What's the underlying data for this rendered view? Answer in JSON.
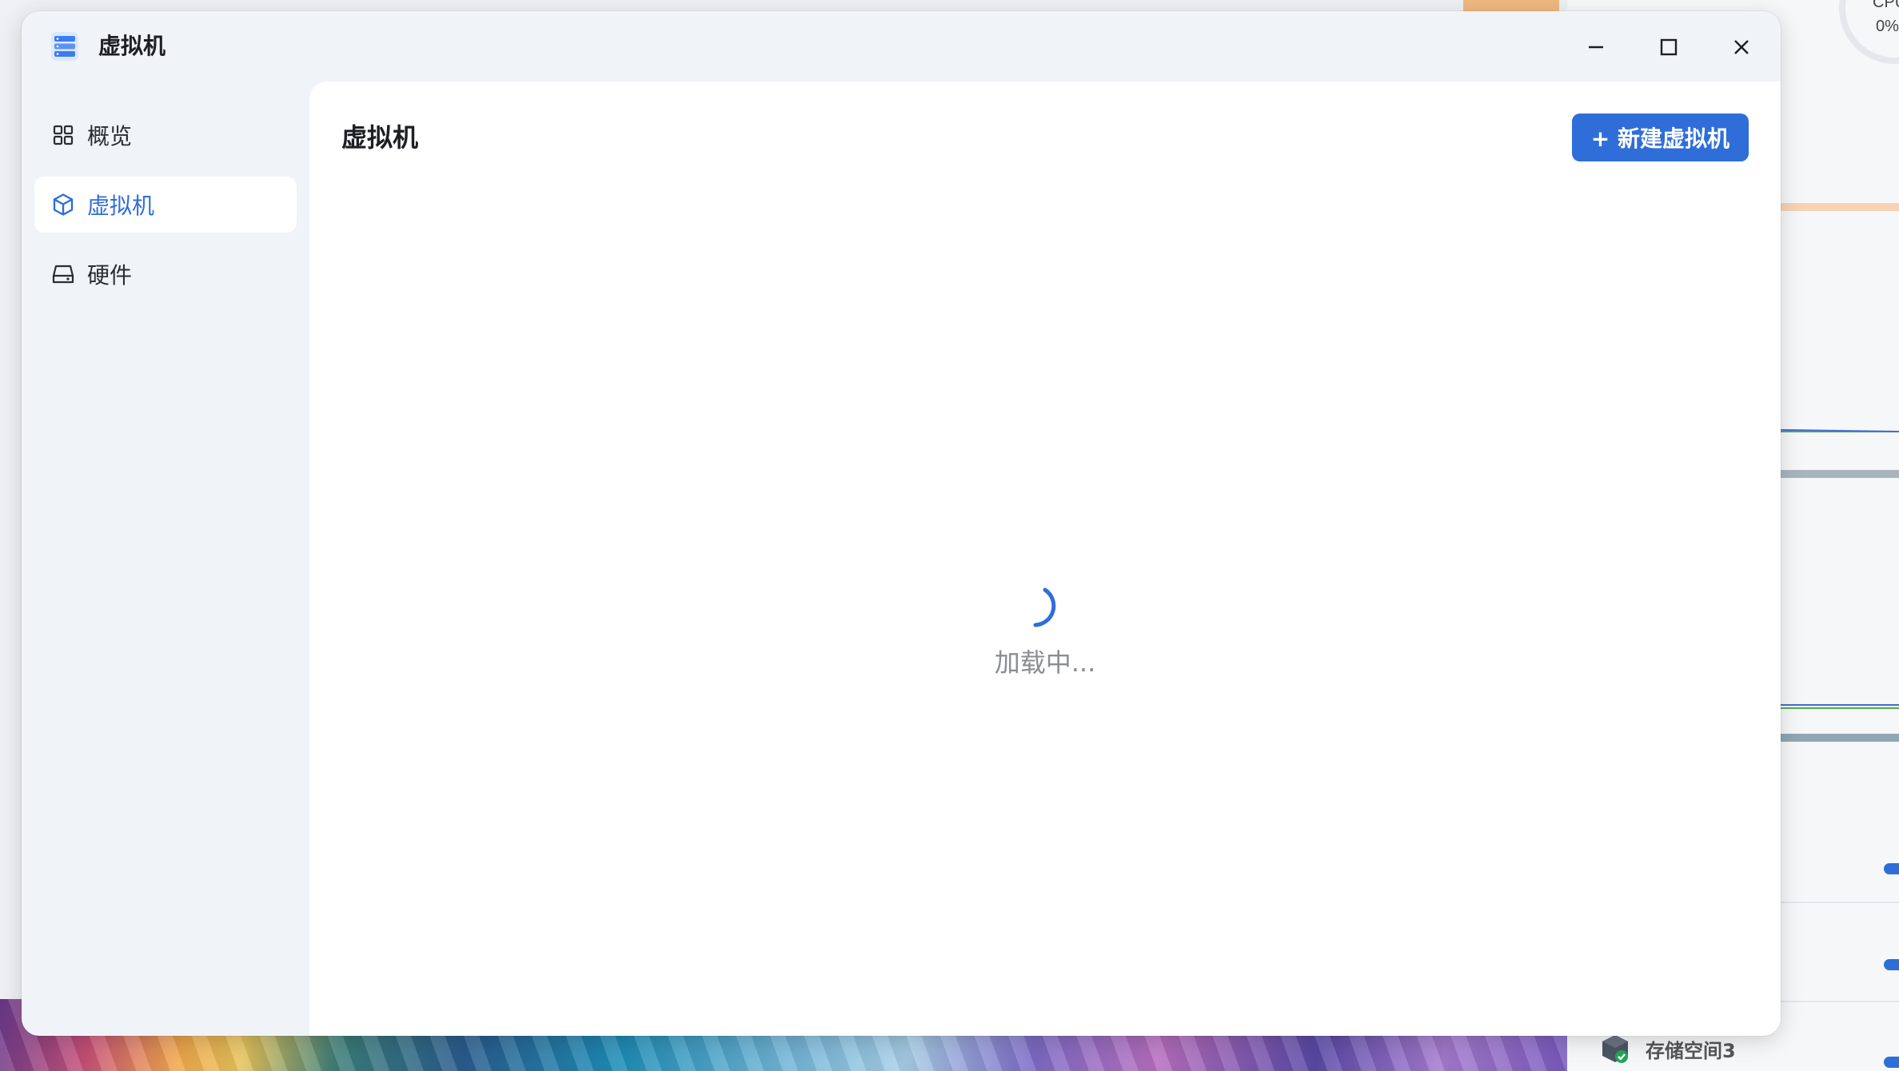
{
  "app": {
    "title": "虚拟机",
    "icon": "server-stack-icon"
  },
  "window_controls": {
    "minimize": "minimize-icon",
    "maximize": "maximize-icon",
    "close": "close-icon"
  },
  "sidebar": {
    "items": [
      {
        "label": "概览",
        "icon": "grid-icon",
        "active": false
      },
      {
        "label": "虚拟机",
        "icon": "cube-icon",
        "active": true
      },
      {
        "label": "硬件",
        "icon": "hard-drive-icon",
        "active": false
      }
    ]
  },
  "main": {
    "title": "虚拟机",
    "new_button_label": "+ 新建虚拟机",
    "loading_text": "加载中..."
  },
  "background": {
    "cpu_label": "CPU",
    "cpu_value": "0%",
    "storage_item_label": "存储空间3"
  },
  "colors": {
    "accent": "#2f6ed8",
    "window_bg": "#f0f3f8",
    "content_bg": "#ffffff",
    "loading_text": "#8a8d93"
  }
}
